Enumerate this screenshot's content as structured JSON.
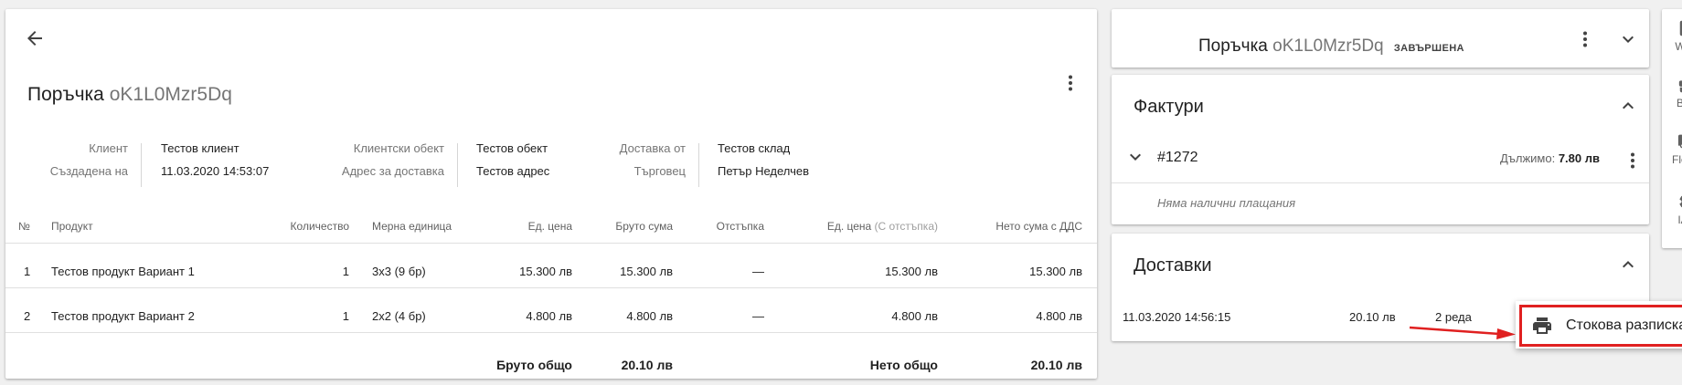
{
  "order": {
    "title_prefix": "Поръчка",
    "code": "oK1L0Mzr5Dq"
  },
  "info": {
    "client_label": "Клиент",
    "client_value": "Тестов клиент",
    "created_label": "Създадена на",
    "created_value": "11.03.2020 14:53:07",
    "object_label": "Клиентски обект",
    "object_value": "Тестов обект",
    "address_label": "Адрес за доставка",
    "address_value": "Тестов адрес",
    "delivery_from_label": "Доставка от",
    "delivery_from_value": "Тестов склад",
    "trader_label": "Търговец",
    "trader_value": "Петър Неделчев"
  },
  "table": {
    "headers": {
      "num": "№",
      "product": "Продукт",
      "qty": "Количество",
      "unit": "Мерна единица",
      "unit_price": "Ед. цена",
      "gross": "Бруто сума",
      "discount": "Отстъпка",
      "unit_price_disc": "Ед. цена",
      "unit_price_disc_note": "(С отстъпка)",
      "net_vat": "Нето сума с ДДС"
    },
    "rows": [
      {
        "num": "1",
        "product": "Тестов продукт Вариант 1",
        "qty": "1",
        "unit": "3x3 (9 бр)",
        "unit_price": "15.300 лв",
        "gross": "15.300 лв",
        "discount": "—",
        "unit_price_disc": "15.300 лв",
        "net_vat": "15.300 лв"
      },
      {
        "num": "2",
        "product": "Тестов продукт Вариант 2",
        "qty": "1",
        "unit": "2x2 (4 бр)",
        "unit_price": "4.800 лв",
        "gross": "4.800 лв",
        "discount": "—",
        "unit_price_disc": "4.800 лв",
        "net_vat": "4.800 лв"
      }
    ],
    "totals": {
      "gross_label": "Бруто общо",
      "gross_value": "20.10 лв",
      "net_label": "Нето общо",
      "net_value": "20.10 лв"
    }
  },
  "summary": {
    "status": "ЗАВЪРШЕНА"
  },
  "invoices": {
    "title": "Фактури",
    "number": "#1272",
    "due_label": "Дължимо:",
    "due_value": "7.80 лв",
    "no_payments": "Няма налични плащания"
  },
  "deliveries": {
    "title": "Доставки",
    "date": "11.03.2020 14:56:15",
    "amount": "20.10 лв",
    "rows": "2 реда"
  },
  "rail": [
    {
      "label": "WSS",
      "icon": "clipboard-icon"
    },
    {
      "label": "BSS",
      "icon": "briefcase-icon"
    },
    {
      "label": "Fleerp",
      "icon": "truck-icon"
    },
    {
      "label": "IAM",
      "icon": "gear-icon"
    }
  ],
  "print_menu": {
    "label": "Стокова разписка",
    "icon": "printer-icon"
  },
  "colors": {
    "highlight_border": "#e02020",
    "arrow": "#e02020"
  }
}
